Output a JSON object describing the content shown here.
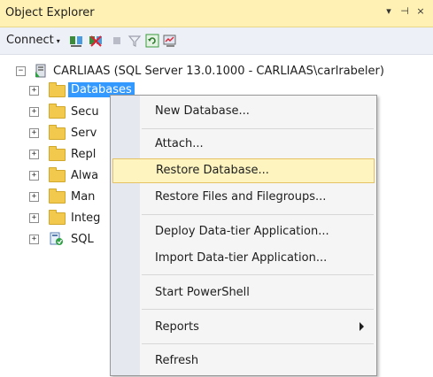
{
  "window": {
    "title": "Object Explorer",
    "dropdown_glyph": "▾",
    "pin_glyph": "⊣",
    "close_glyph": "×"
  },
  "toolbar": {
    "connect_label": "Connect",
    "connect_arrow": "▾",
    "icons": [
      "connect-object-explorer-icon",
      "disconnect-icon",
      "stop-icon",
      "filter-icon",
      "refresh-icon",
      "activity-monitor-icon"
    ]
  },
  "tree": {
    "server": {
      "expander": "−",
      "label": "CARLIAAS (SQL Server 13.0.1000 - CARLIAAS\\carlrabeler)"
    },
    "children": [
      {
        "label": "Databases",
        "expander": "+"
      },
      {
        "label": "Secu",
        "expander": "+"
      },
      {
        "label": "Serv",
        "expander": "+"
      },
      {
        "label": "Repl",
        "expander": "+"
      },
      {
        "label": "Alwa",
        "expander": "+"
      },
      {
        "label": "Man",
        "expander": "+"
      },
      {
        "label": "Integ",
        "expander": "+"
      },
      {
        "label": "SQL",
        "expander": "+"
      }
    ]
  },
  "context_menu": {
    "items": [
      {
        "label": "New Database..."
      },
      {
        "label": "Attach..."
      },
      {
        "label": "Restore Database...",
        "highlighted": true
      },
      {
        "label": "Restore Files and Filegroups..."
      },
      {
        "label": "Deploy Data-tier Application..."
      },
      {
        "label": "Import Data-tier Application..."
      },
      {
        "label": "Start PowerShell"
      },
      {
        "label": "Reports",
        "has_submenu": true
      },
      {
        "label": "Refresh"
      }
    ]
  },
  "colors": {
    "titlebar_bg": "#fff0b3",
    "menu_highlight": "#fdf4bf",
    "menu_highlight_border": "#e5c365",
    "selected_node_bg": "#3399ff"
  }
}
